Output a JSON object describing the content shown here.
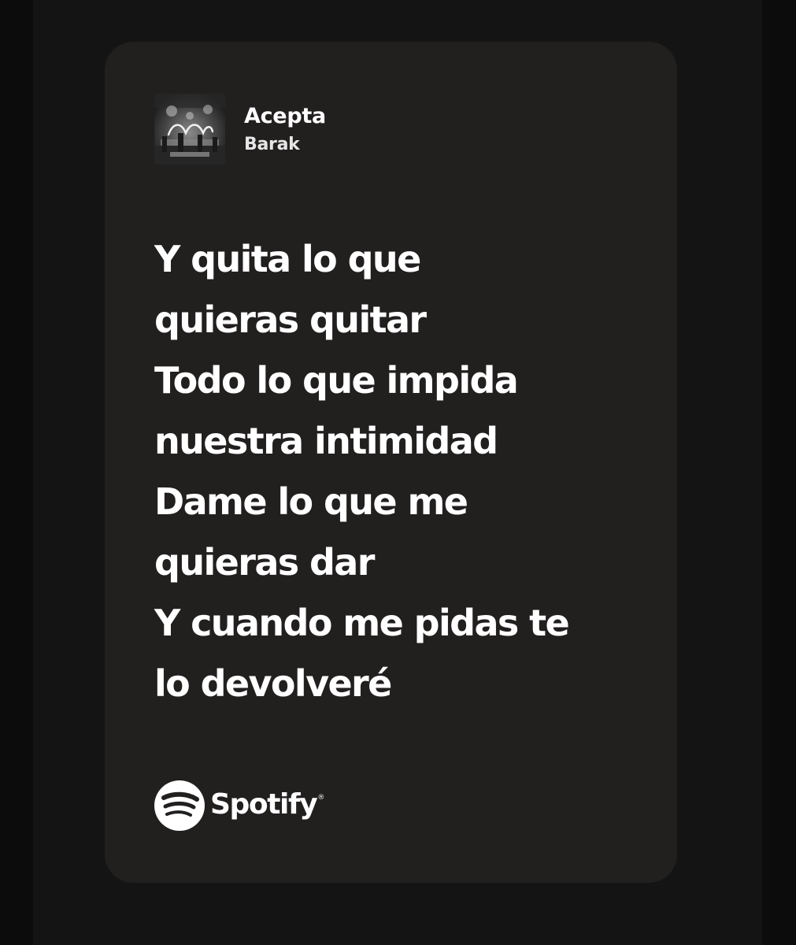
{
  "track": {
    "title": "Acepta",
    "artist": "Barak",
    "cover_icon": "album-cover-art"
  },
  "lyrics": [
    "Y quita lo que",
    "quieras quitar",
    "Todo lo que impida",
    "nuestra intimidad",
    "Dame lo que me",
    "quieras dar",
    "Y cuando me pidas te",
    "lo devolveré"
  ],
  "brand": {
    "name": "Spotify",
    "registered_mark": "®",
    "icon": "spotify-logo-icon"
  },
  "colors": {
    "page_background": "#0c0c0c",
    "card_background": "#221f1f",
    "text": "#ffffff"
  }
}
